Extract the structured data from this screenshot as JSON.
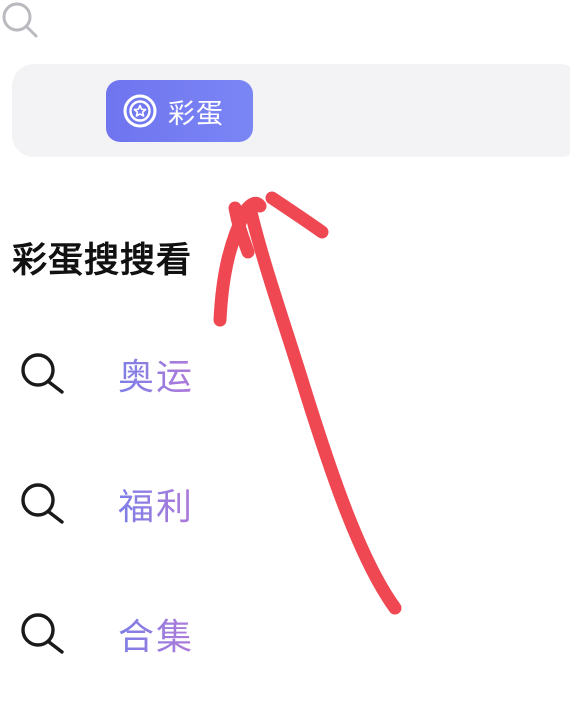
{
  "search": {
    "icon": "search-icon",
    "chip": {
      "label": "彩蛋",
      "icon": "egg-badge-icon",
      "color_start": "#6f74ef",
      "color_end": "#7b86f5"
    }
  },
  "section": {
    "title": "彩蛋搜搜看"
  },
  "suggestions": [
    {
      "label": "奥运",
      "icon": "search-icon"
    },
    {
      "label": "福利",
      "icon": "search-icon"
    },
    {
      "label": "合集",
      "icon": "search-icon"
    }
  ],
  "annotation": {
    "icon": "hand-drawn-arrow-icon",
    "color": "#ef4853"
  }
}
